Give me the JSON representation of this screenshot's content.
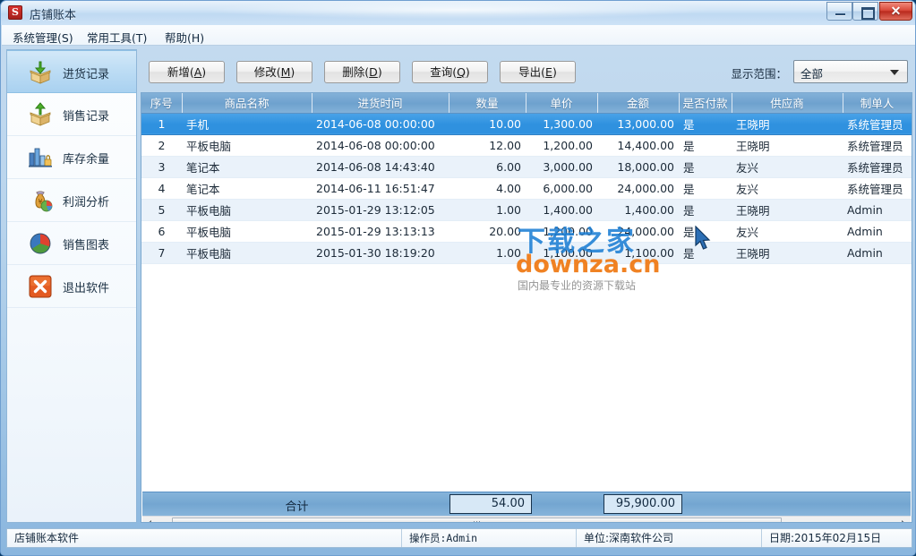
{
  "window": {
    "title": "店铺账本",
    "app_icon_letter": "S",
    "controls": {
      "minimize": "最小化",
      "maximize": "最大化",
      "close": "✕"
    }
  },
  "menubar": {
    "items": [
      {
        "label": "系统管理(S)"
      },
      {
        "label": "常用工具(T)"
      },
      {
        "label": "帮助(H)"
      }
    ]
  },
  "sidebar": {
    "items": [
      {
        "label": "进货记录",
        "icon": "box-in-icon",
        "active": true
      },
      {
        "label": "销售记录",
        "icon": "box-out-icon",
        "active": false
      },
      {
        "label": "库存余量",
        "icon": "bar-chart-lock-icon",
        "active": false
      },
      {
        "label": "利润分析",
        "icon": "money-bag-icon",
        "active": false
      },
      {
        "label": "销售图表",
        "icon": "pie-chart-icon",
        "active": false
      },
      {
        "label": "退出软件",
        "icon": "exit-x-icon",
        "active": false
      }
    ]
  },
  "toolbar": {
    "buttons": [
      {
        "label": "新增(A)",
        "text": "新增(",
        "accel": "A",
        "tail": ")"
      },
      {
        "label": "修改(M)",
        "text": "修改(",
        "accel": "M",
        "tail": ")"
      },
      {
        "label": "删除(D)",
        "text": "删除(",
        "accel": "D",
        "tail": ")"
      },
      {
        "label": "查询(Q)",
        "text": "查询(",
        "accel": "Q",
        "tail": ")"
      },
      {
        "label": "导出(E)",
        "text": "导出(",
        "accel": "E",
        "tail": ")"
      }
    ],
    "range_label": "显示范围：",
    "range_value": "全部"
  },
  "grid": {
    "columns": [
      "序号",
      "商品名称",
      "进货时间",
      "数量",
      "单价",
      "金额",
      "是否付款",
      "供应商",
      "制单人"
    ],
    "rows": [
      {
        "no": "1",
        "name": "手机",
        "time": "2014-06-08 00:00:00",
        "qty": "10.00",
        "price": "1,300.00",
        "amount": "13,000.00",
        "paid": "是",
        "supplier": "王晓明",
        "operator": "系统管理员",
        "selected": true
      },
      {
        "no": "2",
        "name": "平板电脑",
        "time": "2014-06-08 00:00:00",
        "qty": "12.00",
        "price": "1,200.00",
        "amount": "14,400.00",
        "paid": "是",
        "supplier": "王晓明",
        "operator": "系统管理员",
        "selected": false
      },
      {
        "no": "3",
        "name": "笔记本",
        "time": "2014-06-08 14:43:40",
        "qty": "6.00",
        "price": "3,000.00",
        "amount": "18,000.00",
        "paid": "是",
        "supplier": "友兴",
        "operator": "系统管理员",
        "selected": false
      },
      {
        "no": "4",
        "name": "笔记本",
        "time": "2014-06-11 16:51:47",
        "qty": "4.00",
        "price": "6,000.00",
        "amount": "24,000.00",
        "paid": "是",
        "supplier": "友兴",
        "operator": "系统管理员",
        "selected": false
      },
      {
        "no": "5",
        "name": "平板电脑",
        "time": "2015-01-29 13:12:05",
        "qty": "1.00",
        "price": "1,400.00",
        "amount": "1,400.00",
        "paid": "是",
        "supplier": "王晓明",
        "operator": "Admin",
        "selected": false
      },
      {
        "no": "6",
        "name": "平板电脑",
        "time": "2015-01-29 13:13:13",
        "qty": "20.00",
        "price": "1,200.00",
        "amount": "24,000.00",
        "paid": "是",
        "supplier": "友兴",
        "operator": "Admin",
        "selected": false
      },
      {
        "no": "7",
        "name": "平板电脑",
        "time": "2015-01-30 18:19:20",
        "qty": "1.00",
        "price": "1,100.00",
        "amount": "1,100.00",
        "paid": "是",
        "supplier": "王晓明",
        "operator": "Admin",
        "selected": false
      }
    ],
    "totals": {
      "label": "合计",
      "quantity": "54.00",
      "amount": "95,900.00"
    }
  },
  "watermark": {
    "cn": "下载之家",
    "en": "downza.cn",
    "sub": "国内最专业的资源下载站"
  },
  "statusbar": {
    "app_name": "店铺账本软件",
    "operator": "操作员:Admin",
    "company": "单位:深南软件公司",
    "date": "日期:2015年02月15日"
  },
  "colors": {
    "accent": "#2f91df",
    "header": "#6fa2cf",
    "close_button": "#d9493a",
    "watermark_cn": "#1d7fd4",
    "watermark_en": "#f07c18"
  }
}
